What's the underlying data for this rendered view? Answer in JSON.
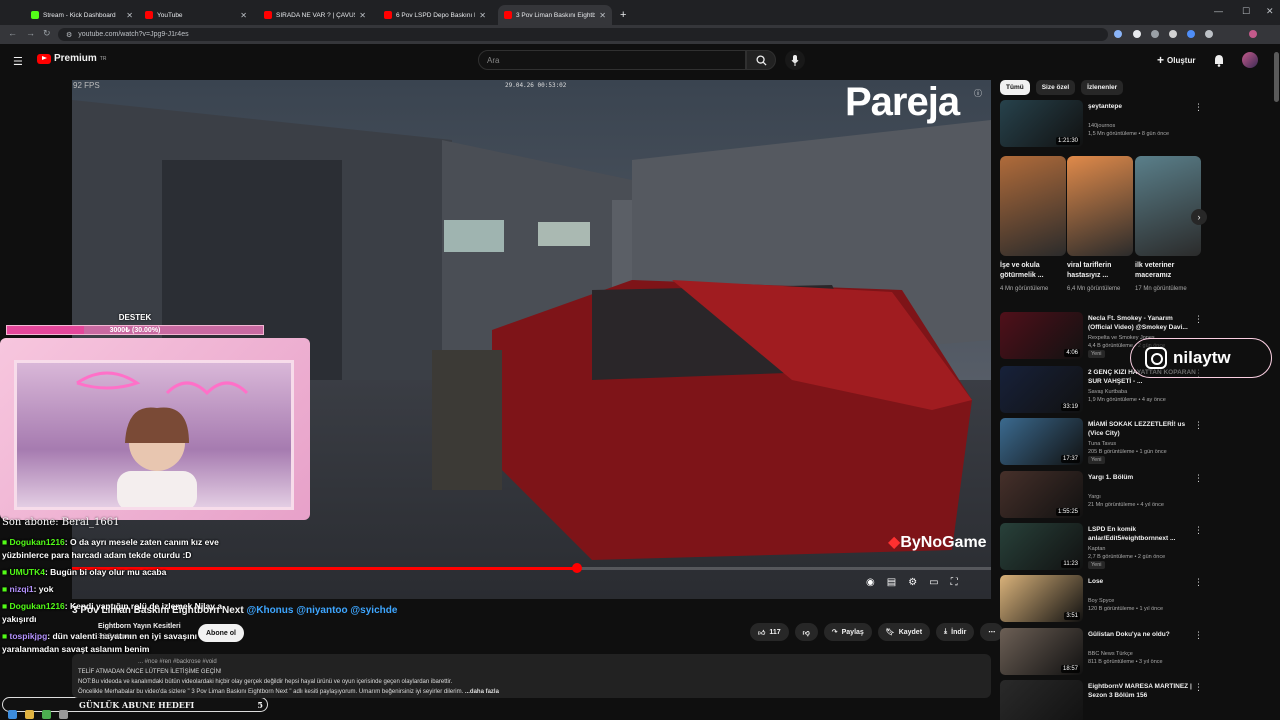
{
  "browser": {
    "tabs": [
      {
        "title": "Stream - Kick Dashboard",
        "active": false,
        "favicon_color": "#53fc18"
      },
      {
        "title": "YouTube",
        "active": false,
        "favicon_color": "#ff0000"
      },
      {
        "title": "SIRADA NE VAR ? | ÇAVUŞ ...",
        "active": false,
        "favicon_color": "#ff0000"
      },
      {
        "title": "6 Pov LSPD Depo Baskını Eight",
        "active": false,
        "favicon_color": "#ff0000"
      },
      {
        "title": "3 Pov Liman Baskını Eightborn I",
        "active": true,
        "favicon_color": "#ff0000"
      }
    ],
    "new_tab": "+",
    "url": "youtube.com/watch?v=Jpg9-J1r4es"
  },
  "youtube": {
    "logo_text": "Premium",
    "logo_sup": "TR",
    "search_placeholder": "Ara",
    "create_label": "Oluştur"
  },
  "player": {
    "fps": "92 FPS",
    "timestamp": "29.04.26 00:53:02",
    "watermark": "Pareja",
    "brand": "ByNoGame",
    "progress": 0.549
  },
  "overlay": {
    "support_title": "DESTEK",
    "support_value": "3000₺ (30.00%)",
    "support_progress": 0.3,
    "last_sub": "Son abone: Beral_1661",
    "chat": [
      {
        "user": "Dogukan1216",
        "msg": ": O da ayrı mesele zaten canım kız eve yüzbinlerce para harcadı adam tekde oturdu :D",
        "green": true
      },
      {
        "user": "UMUTK4",
        "msg": ": Bugün bi olay olur mu acaba",
        "green": true
      },
      {
        "user": "nizqi1",
        "msg": ": yok",
        "green": false
      },
      {
        "user": "Dogukan1216",
        "msg": ": Kendi yaptığın rolü de izlemek Nilay a yakışırdı",
        "green": true
      },
      {
        "user": "tospikjpg",
        "msg": ": dün valenti hayatının en iyi savaşını verdi hiç yaralanmadan savaşt aslanım benim",
        "green": false
      }
    ],
    "goal_label": "GÜNLÜK ABUNE HEDEFI",
    "goal_value": "5",
    "instagram": "nilaytw"
  },
  "video": {
    "title": "3 Pov Liman Baskını Eightborn Next",
    "mentions": "@Khonus @niyantoo @syichde",
    "channel": "Eightborn Yayın Kesitleri",
    "subs": "3,8 B abone",
    "subscribe": "Abone ol",
    "likes": "117",
    "share": "Paylaş",
    "save": "Kaydet",
    "download": "İndir",
    "desc_tags": "... #nce #ren #backrose #void",
    "desc_line1": "TELİF ATMADAN ÖNCE LÜTFEN İLETİŞİME GEÇİN!",
    "desc_line2": "NOT:Bu videoda ve kanalımdaki bütün videolardaki hiçbir olay gerçek değildir hepsi hayal ürünü ve oyun içerisinde geçen olaylardan ibarettir.",
    "desc_line3": "Öncelikle Merhabalar bu video'da sizlere \" 3 Pov Liman Baskını Eightborn Next \" adlı kesiti paylaşıyorum. Umarım beğenirsiniz iyi seyirler dilerim.",
    "desc_more": "...daha fazla"
  },
  "sidebar": {
    "chips": [
      "Tümü",
      "Size özel",
      "İzlenenler"
    ],
    "recs": [
      {
        "title": "şeytantepe",
        "channel": "140journos",
        "meta": "1,5 Mn görüntüleme • 8 gün önce",
        "duration": "1:21:30",
        "color": "#27424c",
        "badge": ""
      },
      {
        "title": "Necla Ft. Smokey - Yanarım (Official Video) @Smokey Davi...",
        "channel": "Rexpelta ve Smokey Jones",
        "meta": "4,4 B görüntüleme • 2 gün önce",
        "duration": "4:06",
        "color": "#50101a",
        "badge": "Yeni"
      },
      {
        "title": "2 GENÇ KIZI HAYATTAN KOPARAN SUR VAHŞETİ - ...",
        "channel": "Savaş Kurtbaba",
        "meta": "1,9 Mn görüntüleme • 4 ay önce",
        "duration": "33:19",
        "color": "#17213a",
        "badge": ""
      },
      {
        "title": "MİAMİ SOKAK LEZZETLERİ! us (Vice City)",
        "channel": "Tuna Tavus",
        "meta": "205 B görüntüleme • 1 gün önce",
        "duration": "17:37",
        "color": "#3b6a8f",
        "badge": "Yeni"
      },
      {
        "title": "Yargı 1. Bölüm",
        "channel": "Yargı",
        "meta": "21 Mn görüntüleme • 4 yıl önce",
        "duration": "1:55:25",
        "color": "#46302a",
        "badge": ""
      },
      {
        "title": "LSPD En komik anlar/Edit5#eightbornnext ...",
        "channel": "Kaptan",
        "meta": "2,7 B görüntüleme • 2 gün önce",
        "duration": "11:23",
        "color": "#28413a",
        "badge": "Yeni"
      },
      {
        "title": "Lose",
        "channel": "Boy Spyce",
        "meta": "120 B görüntüleme • 1 yıl önce",
        "duration": "3:51",
        "color": "#d9b27a",
        "badge": ""
      },
      {
        "title": "Gülistan Doku'ya ne oldu?",
        "channel": "BBC News Türkçe",
        "meta": "811 B görüntüleme • 3 yıl önce",
        "duration": "18:57",
        "color": "#6c5f55",
        "badge": ""
      },
      {
        "title": "EightbornV MARESA MARTINEZ | Sezon 3 Bölüm 156",
        "channel": "",
        "meta": "",
        "duration": "",
        "color": "#2a2a2a",
        "badge": ""
      }
    ],
    "shorts": [
      {
        "title": "İşe ve okula götürmelik ...",
        "views": "4 Mn görüntüleme",
        "color": "#b06b3a"
      },
      {
        "title": "viral tariflerin hastasıyız ...",
        "views": "6,4 Mn görüntüleme",
        "color": "#e08a4a"
      },
      {
        "title": "ilk veteriner maceramız",
        "views": "17 Mn görüntüleme",
        "color": "#5a7f8a"
      }
    ]
  }
}
